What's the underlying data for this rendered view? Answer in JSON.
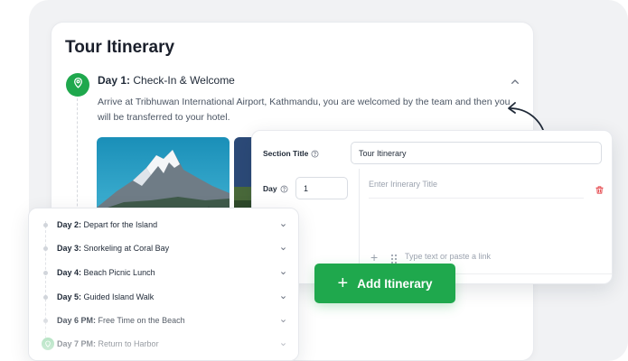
{
  "page": {
    "title": "Tour Itinerary"
  },
  "day1": {
    "label": "Day 1:",
    "title": "Check-In & Welcome",
    "description": "Arrive at Tribhuwan International Airport, Kathmandu, you are welcomed by the team and then you will be transferred to your hotel."
  },
  "form": {
    "section_title_label": "Section Title",
    "section_title_value": "Tour Itinerary",
    "day_label": "Day",
    "day_value": "1",
    "itinerary_title_placeholder": "Enter Irinerary Title",
    "content_placeholder": "Type text or paste a link"
  },
  "add_button": {
    "label": "Add Itinerary"
  },
  "day_list": [
    {
      "label": "Day 2:",
      "title": "Depart for the Island"
    },
    {
      "label": "Day 3:",
      "title": "Snorkeling at Coral Bay"
    },
    {
      "label": "Day 4:",
      "title": "Beach Picnic Lunch"
    },
    {
      "label": "Day 5:",
      "title": "Guided Island Walk"
    },
    {
      "label": "Day 6 PM:",
      "title": "Free Time on the Beach"
    },
    {
      "label": "Day 7 PM:",
      "title": "Return to Harbor"
    }
  ],
  "colors": {
    "accent": "#1fa84d",
    "danger": "#e5484d",
    "muted": "#9ca3af"
  },
  "icons": [
    "map-pin-icon",
    "chevron-up-icon",
    "chevron-down-icon",
    "help-circle-icon",
    "trash-icon",
    "plus-icon",
    "drag-handle-icon",
    "curved-arrow-icon"
  ]
}
